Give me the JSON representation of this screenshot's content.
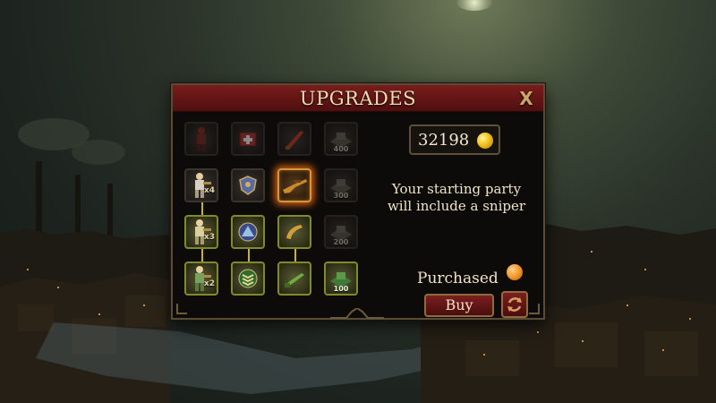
{
  "dialog": {
    "title": "UPGRADES",
    "close_label": "X"
  },
  "wallet": {
    "coins": "32198",
    "coin_icon": "gold-coin-icon"
  },
  "selection": {
    "description": "Your starting party will include a sniper",
    "status_label": "Purchased",
    "status_indicator_color": "#f09122"
  },
  "actions": {
    "buy_label": "Buy",
    "refund_icon": "refresh-icon"
  },
  "upgrade_grid": {
    "rows": [
      [
        {
          "icon": "zombie-figure-icon",
          "state": "locked",
          "cost": "",
          "multiplier": ""
        },
        {
          "icon": "first-aid-kit-icon",
          "state": "locked",
          "cost": "",
          "multiplier": ""
        },
        {
          "icon": "blade-icon",
          "state": "locked",
          "cost": "",
          "multiplier": ""
        },
        {
          "icon": "fortress-icon",
          "state": "locked",
          "cost": "400",
          "multiplier": ""
        }
      ],
      [
        {
          "icon": "soldier-icon",
          "state": "available",
          "cost": "",
          "multiplier": "x4"
        },
        {
          "icon": "shield-badge-icon",
          "state": "available",
          "cost": "",
          "multiplier": ""
        },
        {
          "icon": "sniper-rifle-icon",
          "state": "selected",
          "cost": "",
          "multiplier": ""
        },
        {
          "icon": "fortress-icon",
          "state": "locked",
          "cost": "300",
          "multiplier": ""
        }
      ],
      [
        {
          "icon": "soldier-icon",
          "state": "owned",
          "cost": "",
          "multiplier": "x3"
        },
        {
          "icon": "triangle-badge-icon",
          "state": "owned",
          "cost": "",
          "multiplier": ""
        },
        {
          "icon": "horn-icon",
          "state": "owned",
          "cost": "",
          "multiplier": ""
        },
        {
          "icon": "fortress-icon",
          "state": "locked",
          "cost": "200",
          "multiplier": ""
        }
      ],
      [
        {
          "icon": "soldier-icon",
          "state": "owned",
          "cost": "",
          "multiplier": "x2"
        },
        {
          "icon": "rank-chevrons-icon",
          "state": "owned",
          "cost": "",
          "multiplier": ""
        },
        {
          "icon": "rifle-icon",
          "state": "owned",
          "cost": "",
          "multiplier": ""
        },
        {
          "icon": "fortress-icon",
          "state": "owned",
          "cost": "100",
          "multiplier": ""
        }
      ]
    ]
  }
}
